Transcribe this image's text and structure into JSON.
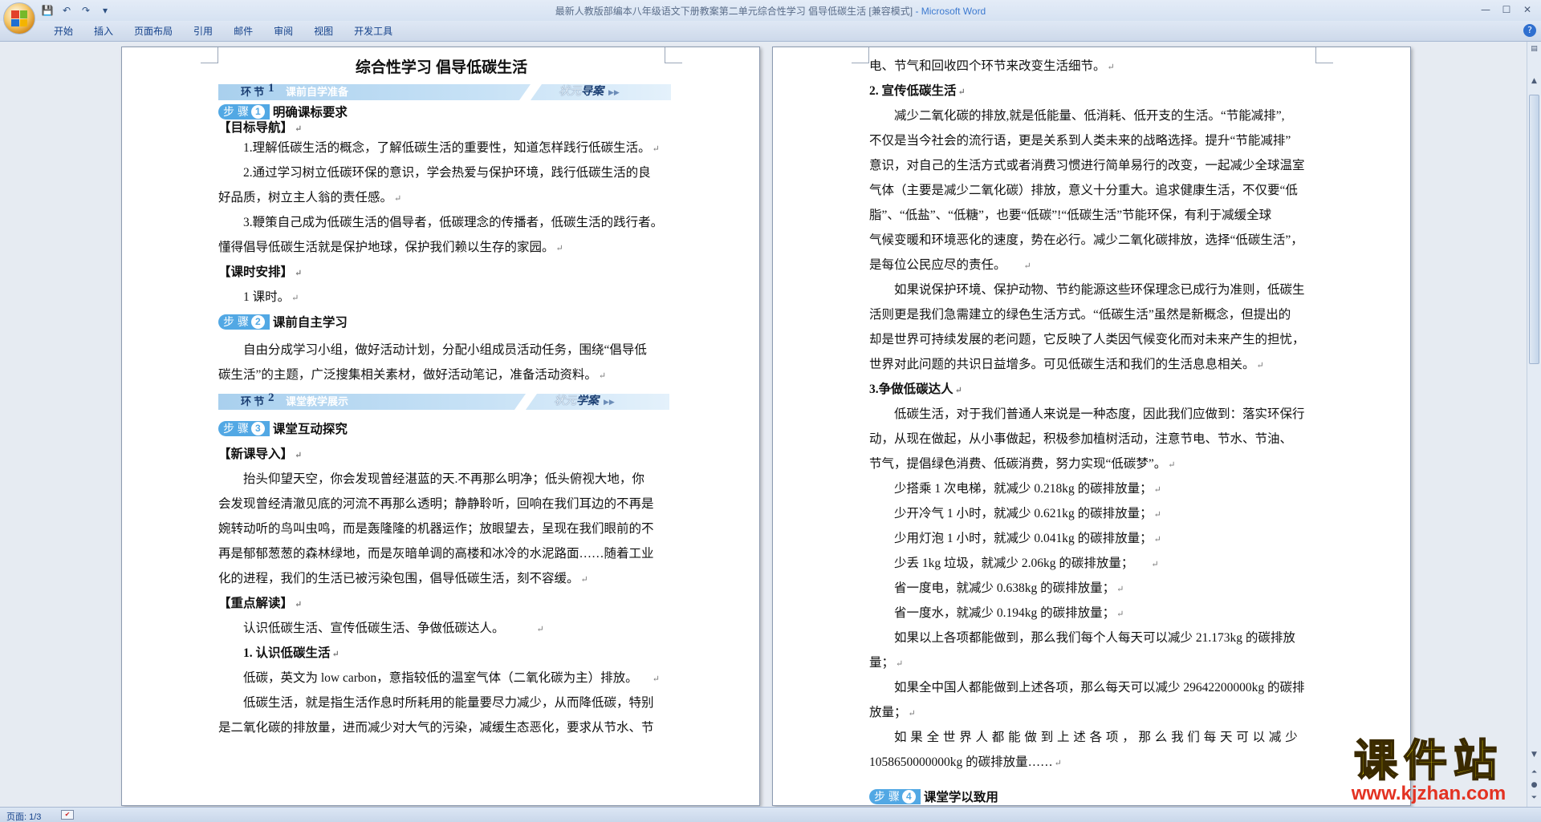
{
  "window": {
    "title": "最新人教版部编本八年级语文下册教案第二单元综合性学习 倡导低碳生活 [兼容模式]",
    "app": " - Microsoft Word"
  },
  "qat": {
    "save": "💾",
    "undo": "↶",
    "redo": "↷",
    "more": "▾"
  },
  "tabs": [
    "开始",
    "插入",
    "页面布局",
    "引用",
    "邮件",
    "审阅",
    "视图",
    "开发工具"
  ],
  "status": {
    "page": "页面: 1/3"
  },
  "watermark": {
    "big": "课件站",
    "small": "www.kjzhan.com"
  },
  "left_page": {
    "title": "综合性学习  倡导低碳生活",
    "banner1": {
      "env": "环 节",
      "num": "1",
      "title": "课前自学准备",
      "right_a": "状元",
      "right_b": "导案"
    },
    "step1": {
      "word": "步 骤",
      "num": "1",
      "label": "明确课标要求"
    },
    "goal_head": "【目标导航】",
    "goal1": "1.理解低碳生活的概念，了解低碳生活的重要性，知道怎样践行低碳生活。",
    "goal2a": "2.通过学习树立低碳环保的意识，学会热爱与保护环境，践行低碳生活的良",
    "goal2b": "好品质，树立主人翁的责任感。",
    "goal3a": "3.鞭策自己成为低碳生活的倡导者，低碳理念的传播者，低碳生活的践行者。",
    "goal3b": "懂得倡导低碳生活就是保护地球，保护我们赖以生存的家园。",
    "time_head": "【课时安排】",
    "time": "1 课时。",
    "step2": {
      "word": "步 骤",
      "num": "2",
      "label": "课前自主学习"
    },
    "self_a": "自由分成学习小组，做好活动计划，分配小组成员活动任务，围绕“倡导低",
    "self_b": "碳生活”的主题，广泛搜集相关素材，做好活动笔记，准备活动资料。",
    "banner2": {
      "env": "环 节",
      "num": "2",
      "title": "课堂教学展示",
      "right_a": "状元",
      "right_b": "学案"
    },
    "step3": {
      "word": "步 骤",
      "num": "3",
      "label": "课堂互动探究"
    },
    "intro_head": "【新课导入】",
    "intro1": "抬头仰望天空，你会发现曾经湛蓝的天.不再那么明净；低头俯视大地，你",
    "intro2": "会发现曾经清澈见底的河流不再那么透明；静静聆听，回响在我们耳边的不再是",
    "intro3": "婉转动听的鸟叫虫鸣，而是轰隆隆的机器运作；放眼望去，呈现在我们眼前的不",
    "intro4": "再是郁郁葱葱的森林绿地，而是灰暗单调的高楼和冰冷的水泥路面……随着工业",
    "intro5": "化的进程，我们的生活已被污染包围，倡导低碳生活，刻不容缓。",
    "key_head": "【重点解读】",
    "key": "认识低碳生活、宣传低碳生活、争做低碳达人。",
    "sec1": "1.  认识低碳生活",
    "low1": "低碳，英文为 low carbon，意指较低的温室气体（二氧化碳为主）排放。",
    "low2a": "低碳生活，就是指生活作息时所耗用的能量要尽力减少，从而降低碳，特别",
    "low2b": "是二氧化碳的排放量，进而减少对大气的污染，减缓生态恶化，要求从节水、节"
  },
  "right_page": {
    "l1": "电、节气和回收四个环节来改变生活细节。",
    "sec2": "2. 宣传低碳生活",
    "p2a": "减少二氧化碳的排放,就是低能量、低消耗、低开支的生活。“节能减排”,",
    "p2b": "不仅是当今社会的流行语，更是关系到人类未来的战略选择。提升“节能减排”",
    "p2c": "意识，对自己的生活方式或者消费习惯进行简单易行的改变，一起减少全球温室",
    "p2d": "气体（主要是减少二氧化碳）排放，意义十分重大。追求健康生活，不仅要“低",
    "p2e": "脂”、“低盐”、“低糖”，也要“低碳”!“低碳生活”节能环保，有利于减缓全球",
    "p2f": "气候变暖和环境恶化的速度，势在必行。减少二氧化碳排放，选择“低碳生活”，",
    "p2g": "是每位公民应尽的责任。",
    "p3a": "如果说保护环境、保护动物、节约能源这些环保理念已成行为准则，低碳生",
    "p3b": "活则更是我们急需建立的绿色生活方式。“低碳生活”虽然是新概念，但提出的",
    "p3c": "却是世界可持续发展的老问题，它反映了人类因气候变化而对未来产生的担忧，",
    "p3d": "世界对此问题的共识日益增多。可见低碳生活和我们的生活息息相关。",
    "sec3": "3.争做低碳达人",
    "p4a": "低碳生活，对于我们普通人来说是一种态度，因此我们应做到：落实环保行",
    "p4b": "动，从现在做起，从小事做起，积极参加植树活动，注意节电、节水、节油、",
    "p4c": "节气，提倡绿色消费、低碳消费，努力实现“低碳梦”。",
    "f1": "少搭乘 1 次电梯，就减少 0.218kg 的碳排放量；",
    "f2": "少开冷气 1 小时，就减少 0.621kg 的碳排放量；",
    "f3": "少用灯泡 1 小时，就减少 0.041kg 的碳排放量；",
    "f4": "少丢 1kg 垃圾，就减少 2.06kg 的碳排放量；",
    "f5": "省一度电，就减少 0.638kg 的碳排放量；",
    "f6": "省一度水，就减少 0.194kg 的碳排放量；",
    "f7a": "如果以上各项都能做到，那么我们每个人每天可以减少 21.173kg 的碳排放",
    "f7b": "量；",
    "f8a": "如果全中国人都能做到上述各项，那么每天可以减少 29642200000kg 的碳排",
    "f8b": "放量；",
    "f9a": "如果全世界人都能做到上述各项，那么我们每天可以减少",
    "f9b": "1058650000000kg 的碳排放量……",
    "step4": {
      "word": "步 骤",
      "num": "4",
      "label": "课堂学以致用"
    }
  }
}
